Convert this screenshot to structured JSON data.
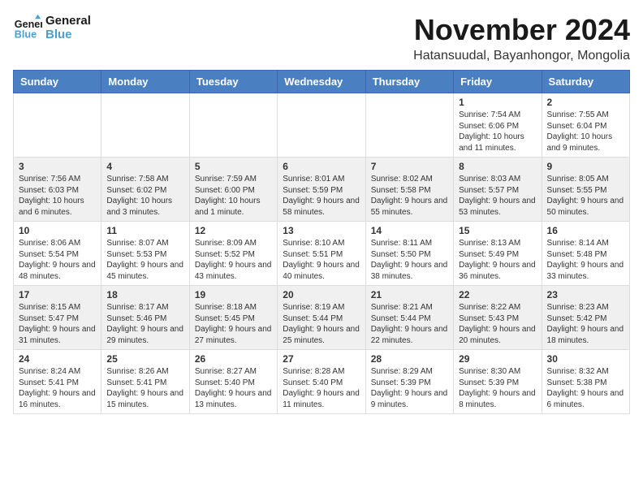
{
  "logo": {
    "line1": "General",
    "line2": "Blue"
  },
  "title": "November 2024",
  "location": "Hatansuudal, Bayanhongor, Mongolia",
  "weekdays": [
    "Sunday",
    "Monday",
    "Tuesday",
    "Wednesday",
    "Thursday",
    "Friday",
    "Saturday"
  ],
  "weeks": [
    [
      {
        "day": "",
        "info": ""
      },
      {
        "day": "",
        "info": ""
      },
      {
        "day": "",
        "info": ""
      },
      {
        "day": "",
        "info": ""
      },
      {
        "day": "",
        "info": ""
      },
      {
        "day": "1",
        "info": "Sunrise: 7:54 AM\nSunset: 6:06 PM\nDaylight: 10 hours and 11 minutes."
      },
      {
        "day": "2",
        "info": "Sunrise: 7:55 AM\nSunset: 6:04 PM\nDaylight: 10 hours and 9 minutes."
      }
    ],
    [
      {
        "day": "3",
        "info": "Sunrise: 7:56 AM\nSunset: 6:03 PM\nDaylight: 10 hours and 6 minutes."
      },
      {
        "day": "4",
        "info": "Sunrise: 7:58 AM\nSunset: 6:02 PM\nDaylight: 10 hours and 3 minutes."
      },
      {
        "day": "5",
        "info": "Sunrise: 7:59 AM\nSunset: 6:00 PM\nDaylight: 10 hours and 1 minute."
      },
      {
        "day": "6",
        "info": "Sunrise: 8:01 AM\nSunset: 5:59 PM\nDaylight: 9 hours and 58 minutes."
      },
      {
        "day": "7",
        "info": "Sunrise: 8:02 AM\nSunset: 5:58 PM\nDaylight: 9 hours and 55 minutes."
      },
      {
        "day": "8",
        "info": "Sunrise: 8:03 AM\nSunset: 5:57 PM\nDaylight: 9 hours and 53 minutes."
      },
      {
        "day": "9",
        "info": "Sunrise: 8:05 AM\nSunset: 5:55 PM\nDaylight: 9 hours and 50 minutes."
      }
    ],
    [
      {
        "day": "10",
        "info": "Sunrise: 8:06 AM\nSunset: 5:54 PM\nDaylight: 9 hours and 48 minutes."
      },
      {
        "day": "11",
        "info": "Sunrise: 8:07 AM\nSunset: 5:53 PM\nDaylight: 9 hours and 45 minutes."
      },
      {
        "day": "12",
        "info": "Sunrise: 8:09 AM\nSunset: 5:52 PM\nDaylight: 9 hours and 43 minutes."
      },
      {
        "day": "13",
        "info": "Sunrise: 8:10 AM\nSunset: 5:51 PM\nDaylight: 9 hours and 40 minutes."
      },
      {
        "day": "14",
        "info": "Sunrise: 8:11 AM\nSunset: 5:50 PM\nDaylight: 9 hours and 38 minutes."
      },
      {
        "day": "15",
        "info": "Sunrise: 8:13 AM\nSunset: 5:49 PM\nDaylight: 9 hours and 36 minutes."
      },
      {
        "day": "16",
        "info": "Sunrise: 8:14 AM\nSunset: 5:48 PM\nDaylight: 9 hours and 33 minutes."
      }
    ],
    [
      {
        "day": "17",
        "info": "Sunrise: 8:15 AM\nSunset: 5:47 PM\nDaylight: 9 hours and 31 minutes."
      },
      {
        "day": "18",
        "info": "Sunrise: 8:17 AM\nSunset: 5:46 PM\nDaylight: 9 hours and 29 minutes."
      },
      {
        "day": "19",
        "info": "Sunrise: 8:18 AM\nSunset: 5:45 PM\nDaylight: 9 hours and 27 minutes."
      },
      {
        "day": "20",
        "info": "Sunrise: 8:19 AM\nSunset: 5:44 PM\nDaylight: 9 hours and 25 minutes."
      },
      {
        "day": "21",
        "info": "Sunrise: 8:21 AM\nSunset: 5:44 PM\nDaylight: 9 hours and 22 minutes."
      },
      {
        "day": "22",
        "info": "Sunrise: 8:22 AM\nSunset: 5:43 PM\nDaylight: 9 hours and 20 minutes."
      },
      {
        "day": "23",
        "info": "Sunrise: 8:23 AM\nSunset: 5:42 PM\nDaylight: 9 hours and 18 minutes."
      }
    ],
    [
      {
        "day": "24",
        "info": "Sunrise: 8:24 AM\nSunset: 5:41 PM\nDaylight: 9 hours and 16 minutes."
      },
      {
        "day": "25",
        "info": "Sunrise: 8:26 AM\nSunset: 5:41 PM\nDaylight: 9 hours and 15 minutes."
      },
      {
        "day": "26",
        "info": "Sunrise: 8:27 AM\nSunset: 5:40 PM\nDaylight: 9 hours and 13 minutes."
      },
      {
        "day": "27",
        "info": "Sunrise: 8:28 AM\nSunset: 5:40 PM\nDaylight: 9 hours and 11 minutes."
      },
      {
        "day": "28",
        "info": "Sunrise: 8:29 AM\nSunset: 5:39 PM\nDaylight: 9 hours and 9 minutes."
      },
      {
        "day": "29",
        "info": "Sunrise: 8:30 AM\nSunset: 5:39 PM\nDaylight: 9 hours and 8 minutes."
      },
      {
        "day": "30",
        "info": "Sunrise: 8:32 AM\nSunset: 5:38 PM\nDaylight: 9 hours and 6 minutes."
      }
    ]
  ]
}
